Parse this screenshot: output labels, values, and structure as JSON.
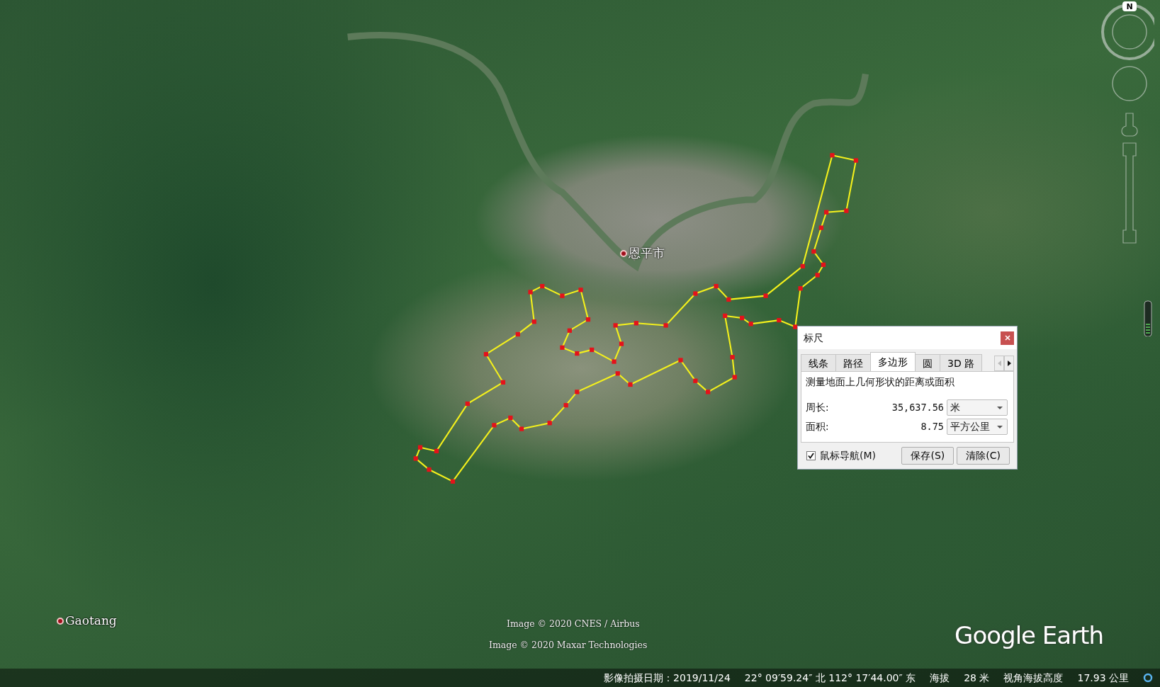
{
  "map": {
    "places": [
      {
        "label": "恩平市"
      },
      {
        "label": "Gaotang"
      }
    ],
    "attributions": [
      "Image © 2020 CNES / Airbus",
      "Image © 2020 Maxar Technologies"
    ],
    "logo": "Google Earth"
  },
  "navigation": {
    "north_label": "N"
  },
  "ruler_dialog": {
    "title": "标尺",
    "tabs": [
      {
        "label": "线条",
        "selected": false
      },
      {
        "label": "路径",
        "selected": false
      },
      {
        "label": "多边形",
        "selected": true
      },
      {
        "label": "圆",
        "selected": false
      },
      {
        "label": "3D 路",
        "selected": false
      }
    ],
    "description": "测量地面上几何形状的距离或面积",
    "measurements": [
      {
        "label": "周长:",
        "value": "35,637.56",
        "unit": "米"
      },
      {
        "label": "面积:",
        "value": "8.75",
        "unit": "平方公里"
      }
    ],
    "mouse_navigation": {
      "label": "鼠标导航(M)",
      "checked": true
    },
    "buttons": [
      "保存(S)",
      "清除(C)"
    ]
  },
  "status_bar": {
    "imagery_date": "影像拍摄日期：2019/11/24",
    "coordinates": "22° 09′59.24″ 北 112° 17′44.00″ 东",
    "elevation_label": "海拔",
    "elevation": "28 米",
    "eye_alt_label": "视角海拔高度",
    "eye_alt": "17.93 公里"
  }
}
